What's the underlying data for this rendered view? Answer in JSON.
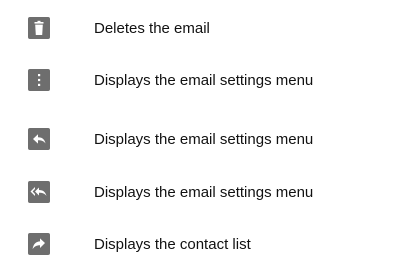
{
  "legend": {
    "items": [
      {
        "icon": "trash-icon",
        "label": "Deletes the email"
      },
      {
        "icon": "more-vertical-icon",
        "label": "Displays the email settings menu"
      },
      {
        "icon": "reply-icon",
        "label": "Displays the email settings menu"
      },
      {
        "icon": "reply-all-icon",
        "label": "Displays the email settings menu"
      },
      {
        "icon": "forward-icon",
        "label": "Displays the contact list"
      }
    ]
  },
  "colors": {
    "icon_bg": "#6e6e6e",
    "icon_fg": "#ffffff",
    "text": "#111111"
  }
}
